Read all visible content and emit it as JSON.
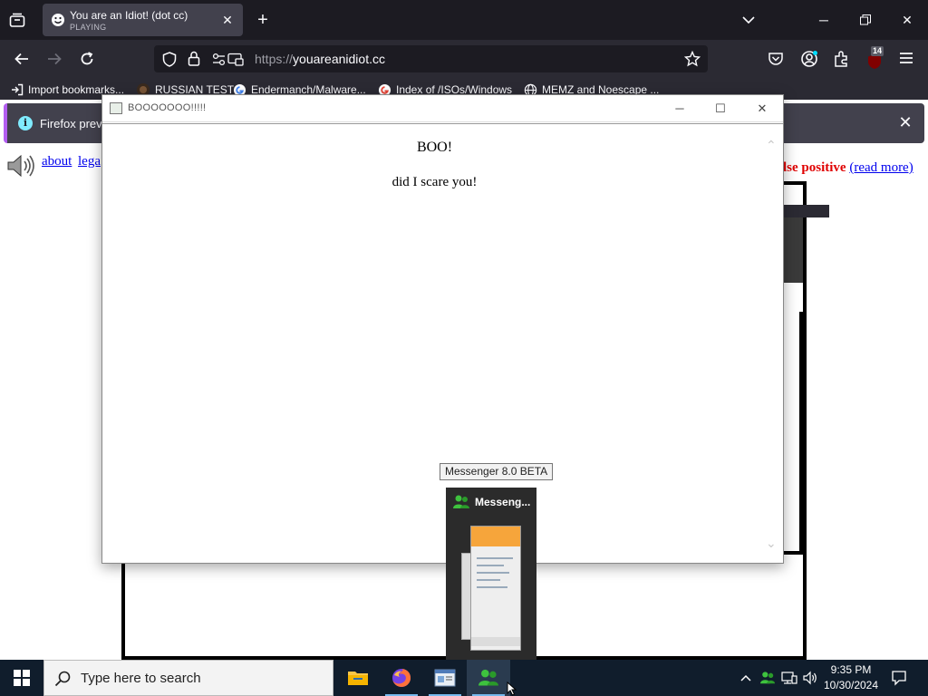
{
  "browser": {
    "tab": {
      "title": "You are an Idiot! (dot cc)",
      "status": "PLAYING"
    },
    "url": {
      "scheme": "https://",
      "host": "youareanidiot.cc"
    },
    "extensions_badge": "14",
    "bookmarks": [
      {
        "label": "Import bookmarks...",
        "icon": "import-icon"
      },
      {
        "label": "RUSSIAN TEST",
        "icon": "github-icon"
      },
      {
        "label": "Endermanch/Malware...",
        "icon": "google-icon"
      },
      {
        "label": "Index of /ISOs/Windows",
        "icon": "google-icon"
      },
      {
        "label": "MEMZ and Noescape ...",
        "icon": "globe-icon"
      }
    ],
    "notification": {
      "text": "Firefox prever"
    }
  },
  "page": {
    "links": [
      "about",
      "lega"
    ],
    "false_positive_text": "lse positive",
    "read_more": "(read more)"
  },
  "popup": {
    "window_title": "BOOOOOOO!!!!!",
    "heading": "BOO!",
    "message": "did I scare you!"
  },
  "taskbar": {
    "search_placeholder": "Type here to search",
    "tooltip": "Messenger 8.0 BETA",
    "thumbnail_title": "Messeng...",
    "time": "9:35 PM",
    "date": "10/30/2024"
  },
  "colors": {
    "chrome_dark": "#1c1b22",
    "toolbar": "#2b2a33",
    "tab_active": "#42414d",
    "notice_accent": "#b35ef0",
    "warning_red": "#e00000",
    "link_blue": "#0000ee",
    "taskbar": "#101d2c"
  }
}
